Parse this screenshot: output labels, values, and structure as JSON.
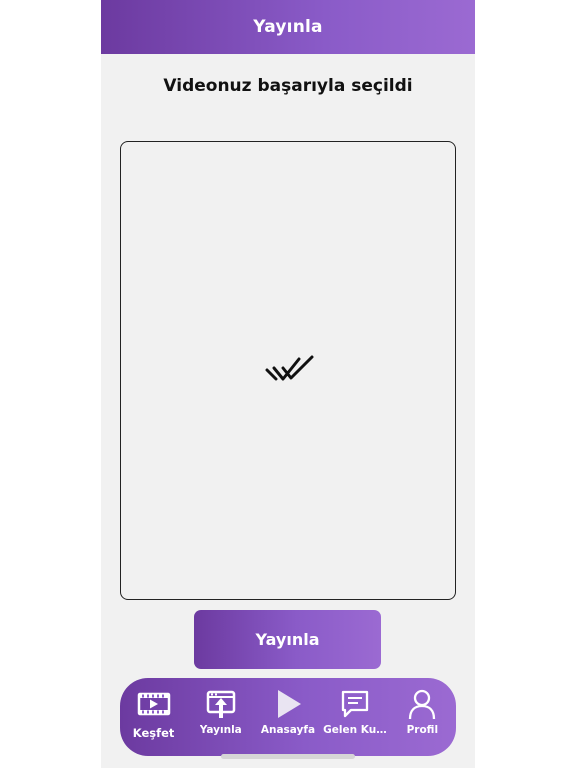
{
  "header": {
    "title": "Yayınla"
  },
  "main": {
    "subtitle": "Videonuz başarıyla seçildi",
    "preview_icon": "double-check-icon",
    "publish_label": "Yayınla"
  },
  "tabbar": {
    "items": [
      {
        "label": "Keşfet",
        "icon": "film-icon",
        "active": true
      },
      {
        "label": "Yayınla",
        "icon": "upload-icon",
        "active": false
      },
      {
        "label": "Anasayfa",
        "icon": "play-icon",
        "active": false
      },
      {
        "label": "Gelen Kut...",
        "icon": "chat-icon",
        "active": false
      },
      {
        "label": "Profil",
        "icon": "person-icon",
        "active": false
      }
    ]
  },
  "colors": {
    "accent_start": "#6c3aa0",
    "accent_end": "#9b6ad2",
    "background": "#f1f1f1"
  }
}
